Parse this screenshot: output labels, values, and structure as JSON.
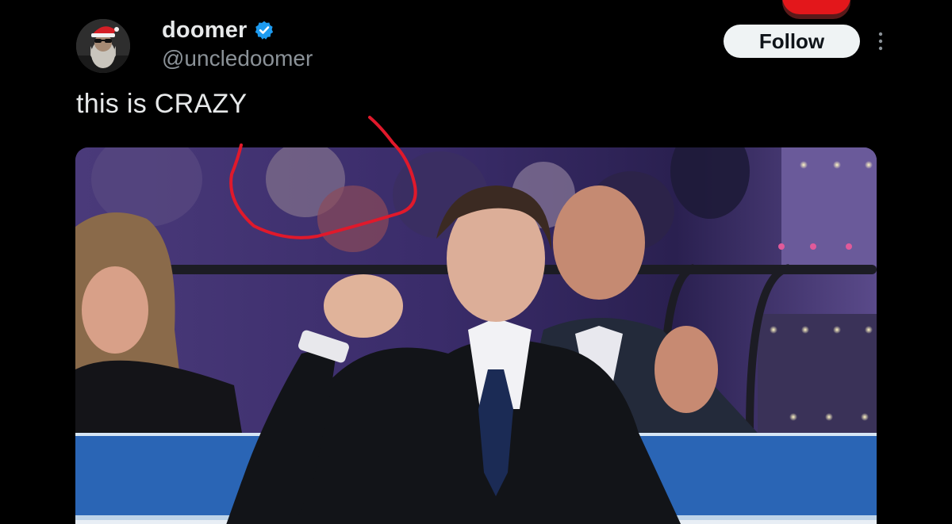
{
  "tweet": {
    "author": {
      "display_name": "doomer",
      "handle": "@uncledoomer",
      "verified": true,
      "avatar_icon": "bearded-man-santa-hat-avatar"
    },
    "follow_label": "Follow",
    "more_icon": "more-vertical-icon",
    "text": "this is CRAZY",
    "media": {
      "type": "photo",
      "annotation_color": "#e0192b"
    }
  },
  "colors": {
    "background": "#000000",
    "verified_badge": "#1d9bf0",
    "follow_button_bg": "#eff3f4",
    "handle_text": "#8b9298"
  }
}
